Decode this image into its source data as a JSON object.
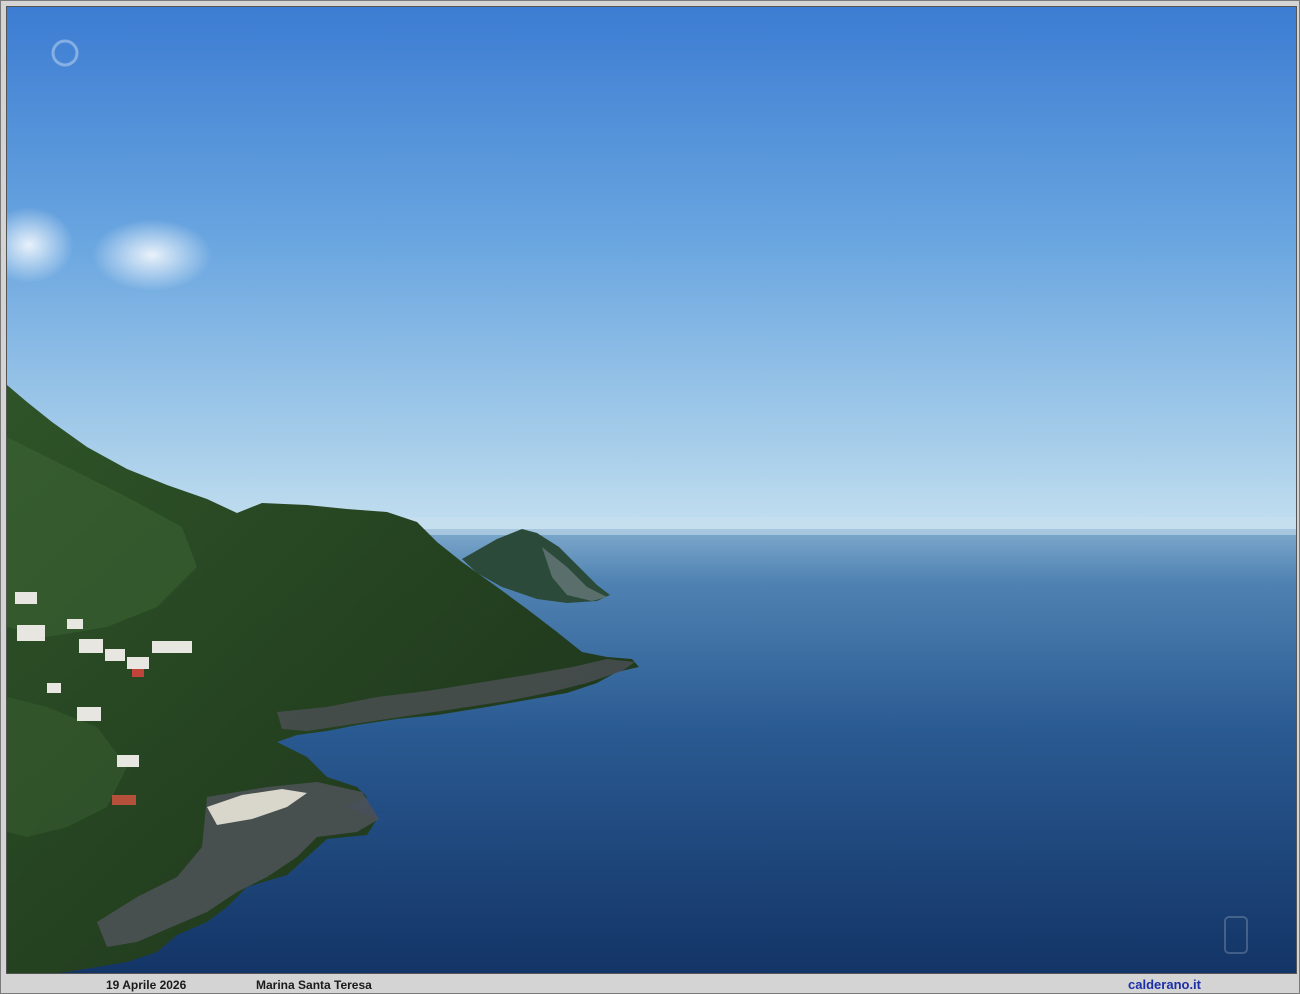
{
  "photo": {
    "scene": "coastal-landscape",
    "colors": {
      "sky_top": "#3f7fd4",
      "sky_horizon": "#b9d8ee",
      "sea_far": "#5f8fb8",
      "sea_near": "#173a6e",
      "vegetation": "#24401f"
    }
  },
  "caption": {
    "date": "19 Aprile 2026",
    "place": "Marina Santa Teresa",
    "site": "calderano.it"
  }
}
